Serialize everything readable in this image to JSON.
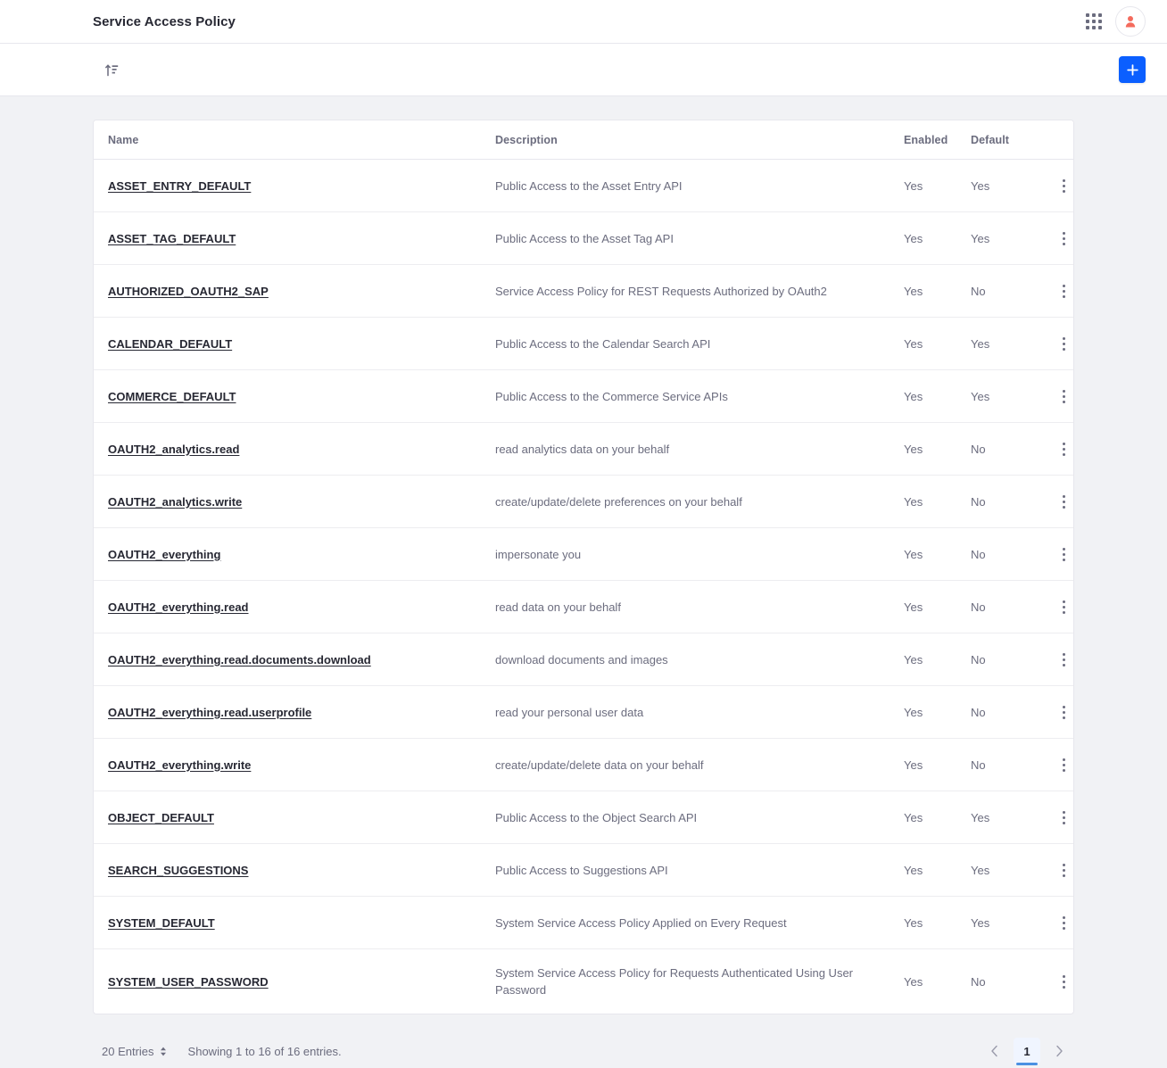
{
  "header": {
    "title": "Service Access Policy",
    "apps_icon": "grid-apps-icon",
    "avatar_icon": "user-avatar-icon"
  },
  "toolbar": {
    "sort_icon": "sort-ascending-icon",
    "add_icon": "plus-icon"
  },
  "table": {
    "columns": [
      "Name",
      "Description",
      "Enabled",
      "Default"
    ],
    "rows": [
      {
        "name": "ASSET_ENTRY_DEFAULT",
        "description": "Public Access to the Asset Entry API",
        "enabled": "Yes",
        "default": "Yes"
      },
      {
        "name": "ASSET_TAG_DEFAULT",
        "description": "Public Access to the Asset Tag API",
        "enabled": "Yes",
        "default": "Yes"
      },
      {
        "name": "AUTHORIZED_OAUTH2_SAP",
        "description": "Service Access Policy for REST Requests Authorized by OAuth2",
        "enabled": "Yes",
        "default": "No"
      },
      {
        "name": "CALENDAR_DEFAULT",
        "description": "Public Access to the Calendar Search API",
        "enabled": "Yes",
        "default": "Yes"
      },
      {
        "name": "COMMERCE_DEFAULT",
        "description": "Public Access to the Commerce Service APIs",
        "enabled": "Yes",
        "default": "Yes"
      },
      {
        "name": "OAUTH2_analytics.read",
        "description": "read analytics data on your behalf",
        "enabled": "Yes",
        "default": "No"
      },
      {
        "name": "OAUTH2_analytics.write",
        "description": "create/update/delete preferences on your behalf",
        "enabled": "Yes",
        "default": "No"
      },
      {
        "name": "OAUTH2_everything",
        "description": "impersonate you",
        "enabled": "Yes",
        "default": "No"
      },
      {
        "name": "OAUTH2_everything.read",
        "description": "read data on your behalf",
        "enabled": "Yes",
        "default": "No"
      },
      {
        "name": "OAUTH2_everything.read.documents.download",
        "description": "download documents and images",
        "enabled": "Yes",
        "default": "No"
      },
      {
        "name": "OAUTH2_everything.read.userprofile",
        "description": "read your personal user data",
        "enabled": "Yes",
        "default": "No"
      },
      {
        "name": "OAUTH2_everything.write",
        "description": "create/update/delete data on your behalf",
        "enabled": "Yes",
        "default": "No"
      },
      {
        "name": "OBJECT_DEFAULT",
        "description": "Public Access to the Object Search API",
        "enabled": "Yes",
        "default": "Yes"
      },
      {
        "name": "SEARCH_SUGGESTIONS",
        "description": "Public Access to Suggestions API",
        "enabled": "Yes",
        "default": "Yes"
      },
      {
        "name": "SYSTEM_DEFAULT",
        "description": "System Service Access Policy Applied on Every Request",
        "enabled": "Yes",
        "default": "Yes"
      },
      {
        "name": "SYSTEM_USER_PASSWORD",
        "description": "System Service Access Policy for Requests Authenticated Using User Password",
        "enabled": "Yes",
        "default": "No"
      }
    ],
    "row_menu_icon": "kebab-menu-icon"
  },
  "footer": {
    "entries_per_page": "20 Entries",
    "showing_text": "Showing 1 to 16 of 16 entries.",
    "prev_icon": "chevron-left-icon",
    "next_icon": "chevron-right-icon",
    "current_page": "1"
  },
  "colors": {
    "accent": "#0b5fff",
    "page_background": "#f1f2f5",
    "card_background": "#ffffff",
    "text_primary": "#272833",
    "text_secondary": "#6b6c7e",
    "border": "#e7e7ed",
    "avatar": "#f46b5d",
    "pager_active_bg": "#f0f5ff",
    "pager_active_bar": "#4a90e2"
  }
}
